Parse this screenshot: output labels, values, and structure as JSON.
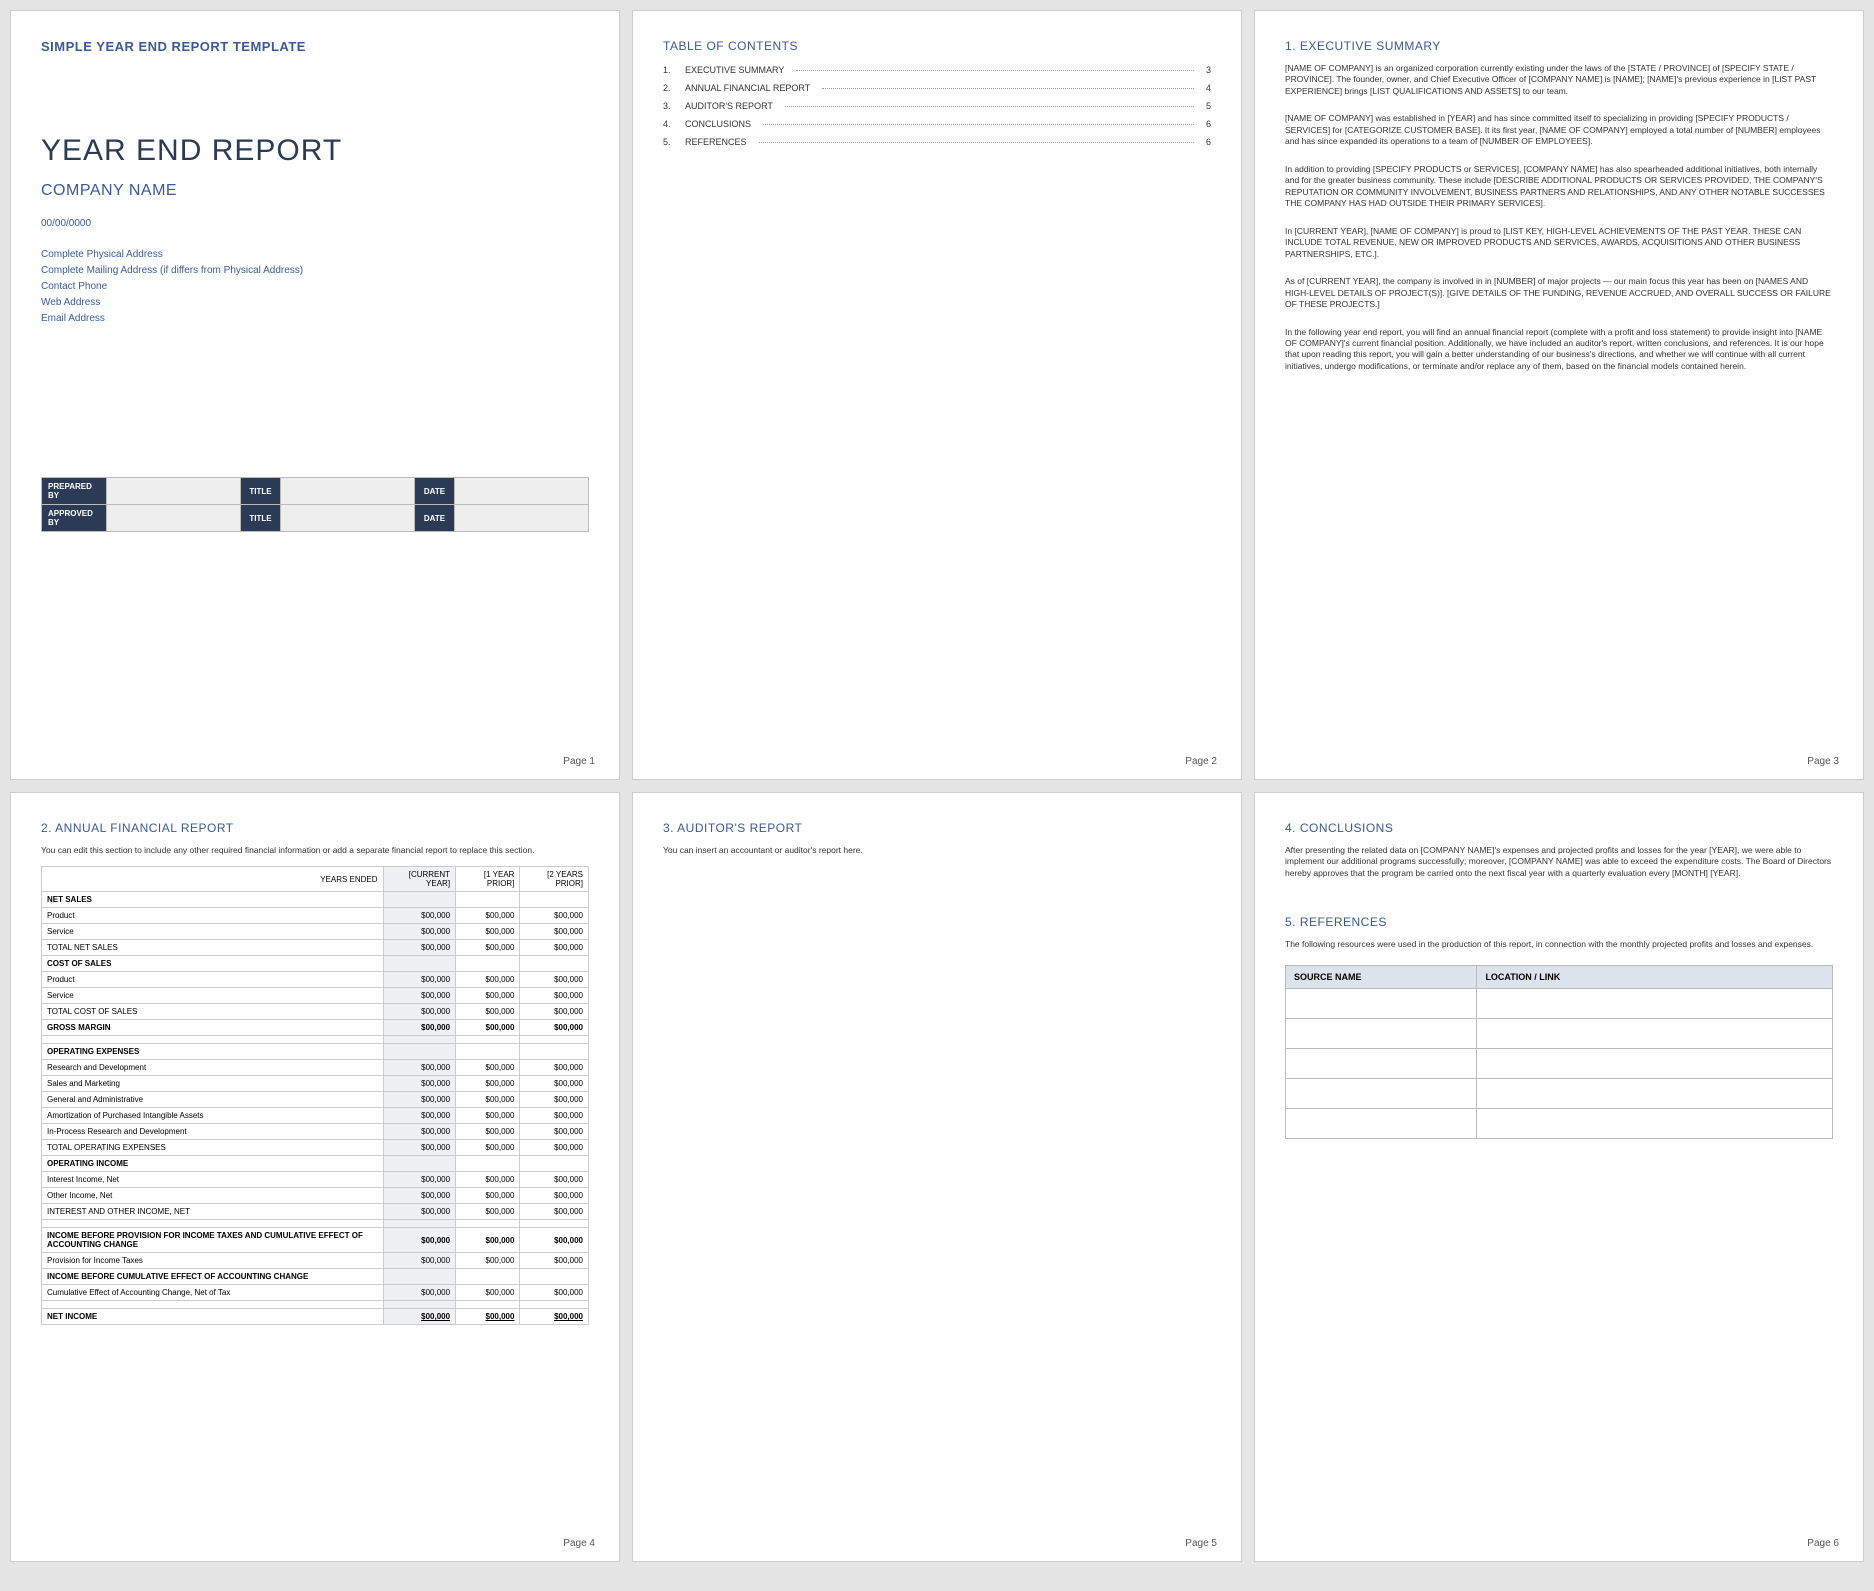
{
  "page_labels": {
    "p1": "Page 1",
    "p2": "Page 2",
    "p3": "Page 3",
    "p4": "Page 4",
    "p5": "Page 5",
    "p6": "Page 6"
  },
  "p1": {
    "template_title": "SIMPLE YEAR END REPORT TEMPLATE",
    "report_title": "YEAR END REPORT",
    "company_name": "COMPANY NAME",
    "date": "00/00/0000",
    "addr": {
      "physical": "Complete Physical Address",
      "mailing": "Complete Mailing Address (if differs from Physical Address)",
      "phone": "Contact Phone",
      "web": "Web Address",
      "email": "Email Address"
    },
    "sig": {
      "prepared_by": "PREPARED BY",
      "approved_by": "APPROVED BY",
      "title": "TITLE",
      "date": "DATE"
    }
  },
  "p2": {
    "toc_heading": "TABLE OF CONTENTS",
    "items": [
      {
        "label": "EXECUTIVE SUMMARY",
        "pg": "3"
      },
      {
        "label": "ANNUAL FINANCIAL REPORT",
        "pg": "4"
      },
      {
        "label": "AUDITOR'S REPORT",
        "pg": "5"
      },
      {
        "label": "CONCLUSIONS",
        "pg": "6"
      },
      {
        "label": "REFERENCES",
        "pg": "6"
      }
    ]
  },
  "p3": {
    "heading": "1. EXECUTIVE SUMMARY",
    "para1": "[NAME OF COMPANY] is an organized corporation currently existing under the laws of the [STATE / PROVINCE] of [SPECIFY STATE / PROVINCE]. The founder, owner, and Chief Executive Officer of [COMPANY NAME] is [NAME]; [NAME]'s previous experience in [LIST PAST EXPERIENCE] brings [LIST QUALIFICATIONS AND ASSETS] to our team.",
    "para2": "[NAME OF COMPANY] was established in [YEAR] and has since committed itself to specializing in providing [SPECIFY PRODUCTS / SERVICES] for [CATEGORIZE CUSTOMER BASE]. It its first year, [NAME OF COMPANY] employed a total number of [NUMBER] employees and has since expanded its operations to a team of [NUMBER OF EMPLOYEES].",
    "para3": "In addition to providing [SPECIFY PRODUCTS or SERVICES], [COMPANY NAME] has also spearheaded additional initiatives, both internally and for the greater business community. These include [DESCRIBE ADDITIONAL PRODUCTS OR SERVICES PROVIDED, THE COMPANY'S REPUTATION OR COMMUNITY INVOLVEMENT, BUSINESS PARTNERS AND RELATIONSHIPS, AND ANY OTHER NOTABLE SUCCESSES THE COMPANY HAS HAD OUTSIDE THEIR PRIMARY SERVICES].",
    "para4": "In [CURRENT YEAR], [NAME OF COMPANY] is proud to [LIST KEY, HIGH-LEVEL ACHIEVEMENTS OF THE PAST YEAR. THESE CAN INCLUDE TOTAL REVENUE, NEW OR IMPROVED PRODUCTS AND SERVICES, AWARDS, ACQUISITIONS AND OTHER BUSINESS PARTNERSHIPS, ETC.].",
    "para5": "As of [CURRENT YEAR], the company is involved in in [NUMBER] of major projects — our main focus this year has been on [NAMES AND HIGH-LEVEL DETAILS OF PROJECT(S)]. [GIVE DETAILS OF THE FUNDING, REVENUE ACCRUED, AND OVERALL SUCCESS OR FAILURE OF THESE PROJECTS.]",
    "para6": "In the following year end report, you will find an annual financial report (complete with a profit and loss statement) to provide insight into [NAME OF COMPANY]'s current financial position. Additionally, we have included an auditor's report, written conclusions, and references. It is our hope that upon reading this report, you will gain a better understanding of our business's directions, and whether we will continue with all current initiatives, undergo modifications, or terminate and/or replace any of them, based on the financial models contained herein."
  },
  "p4": {
    "heading": "2. ANNUAL FINANCIAL REPORT",
    "note": "You can edit this section to include any other required financial information or add a separate financial report to replace this section.",
    "cols": {
      "years_ended": "YEARS ENDED",
      "c1": "[CURRENT YEAR]",
      "c2": "[1 YEAR PRIOR]",
      "c3": "[2 YEARS PRIOR]"
    },
    "val": "$00,000",
    "rows": {
      "net_sales": "NET SALES",
      "product": "Product",
      "service": "Service",
      "total_net_sales": "TOTAL NET SALES",
      "cost_of_sales": "COST OF SALES",
      "total_cost_of_sales": "TOTAL COST OF SALES",
      "gross_margin": "GROSS MARGIN",
      "operating_expenses": "OPERATING EXPENSES",
      "rnd": "Research and Development",
      "sales_marketing": "Sales and Marketing",
      "gen_admin": "General and Administrative",
      "amort": "Amortization of Purchased Intangible Assets",
      "inproc_rnd": "In-Process Research and Development",
      "total_op_exp": "TOTAL OPERATING EXPENSES",
      "operating_income": "OPERATING INCOME",
      "interest_income": "Interest Income, Net",
      "other_income": "Other Income, Net",
      "interest_other": "INTEREST AND OTHER INCOME, NET",
      "income_before_prov": "INCOME BEFORE PROVISION FOR INCOME TAXES AND CUMULATIVE EFFECT OF ACCOUNTING CHANGE",
      "prov_tax": "Provision for Income Taxes",
      "income_before_cum": "INCOME BEFORE CUMULATIVE EFFECT OF ACCOUNTING CHANGE",
      "cum_effect": "Cumulative Effect of Accounting Change, Net of Tax",
      "net_income": "NET INCOME"
    }
  },
  "p5": {
    "heading": "3. AUDITOR'S REPORT",
    "note": "You can insert an accountant or auditor's report here."
  },
  "p6": {
    "conclusions_heading": "4. CONCLUSIONS",
    "conclusions_text": "After presenting the related data on [COMPANY NAME]'s expenses and projected profits and losses for the year [YEAR], we were able to implement our additional programs successfully; moreover, [COMPANY NAME] was able to exceed the expenditure costs. The Board of Directors hereby approves that the program be carried onto the next fiscal year with a quarterly evaluation every [MONTH] [YEAR].",
    "references_heading": "5. REFERENCES",
    "references_text": "The following resources were used in the production of this report, in connection with the monthly projected profits and losses and expenses.",
    "ref_cols": {
      "source": "SOURCE NAME",
      "location": "LOCATION / LINK"
    }
  }
}
